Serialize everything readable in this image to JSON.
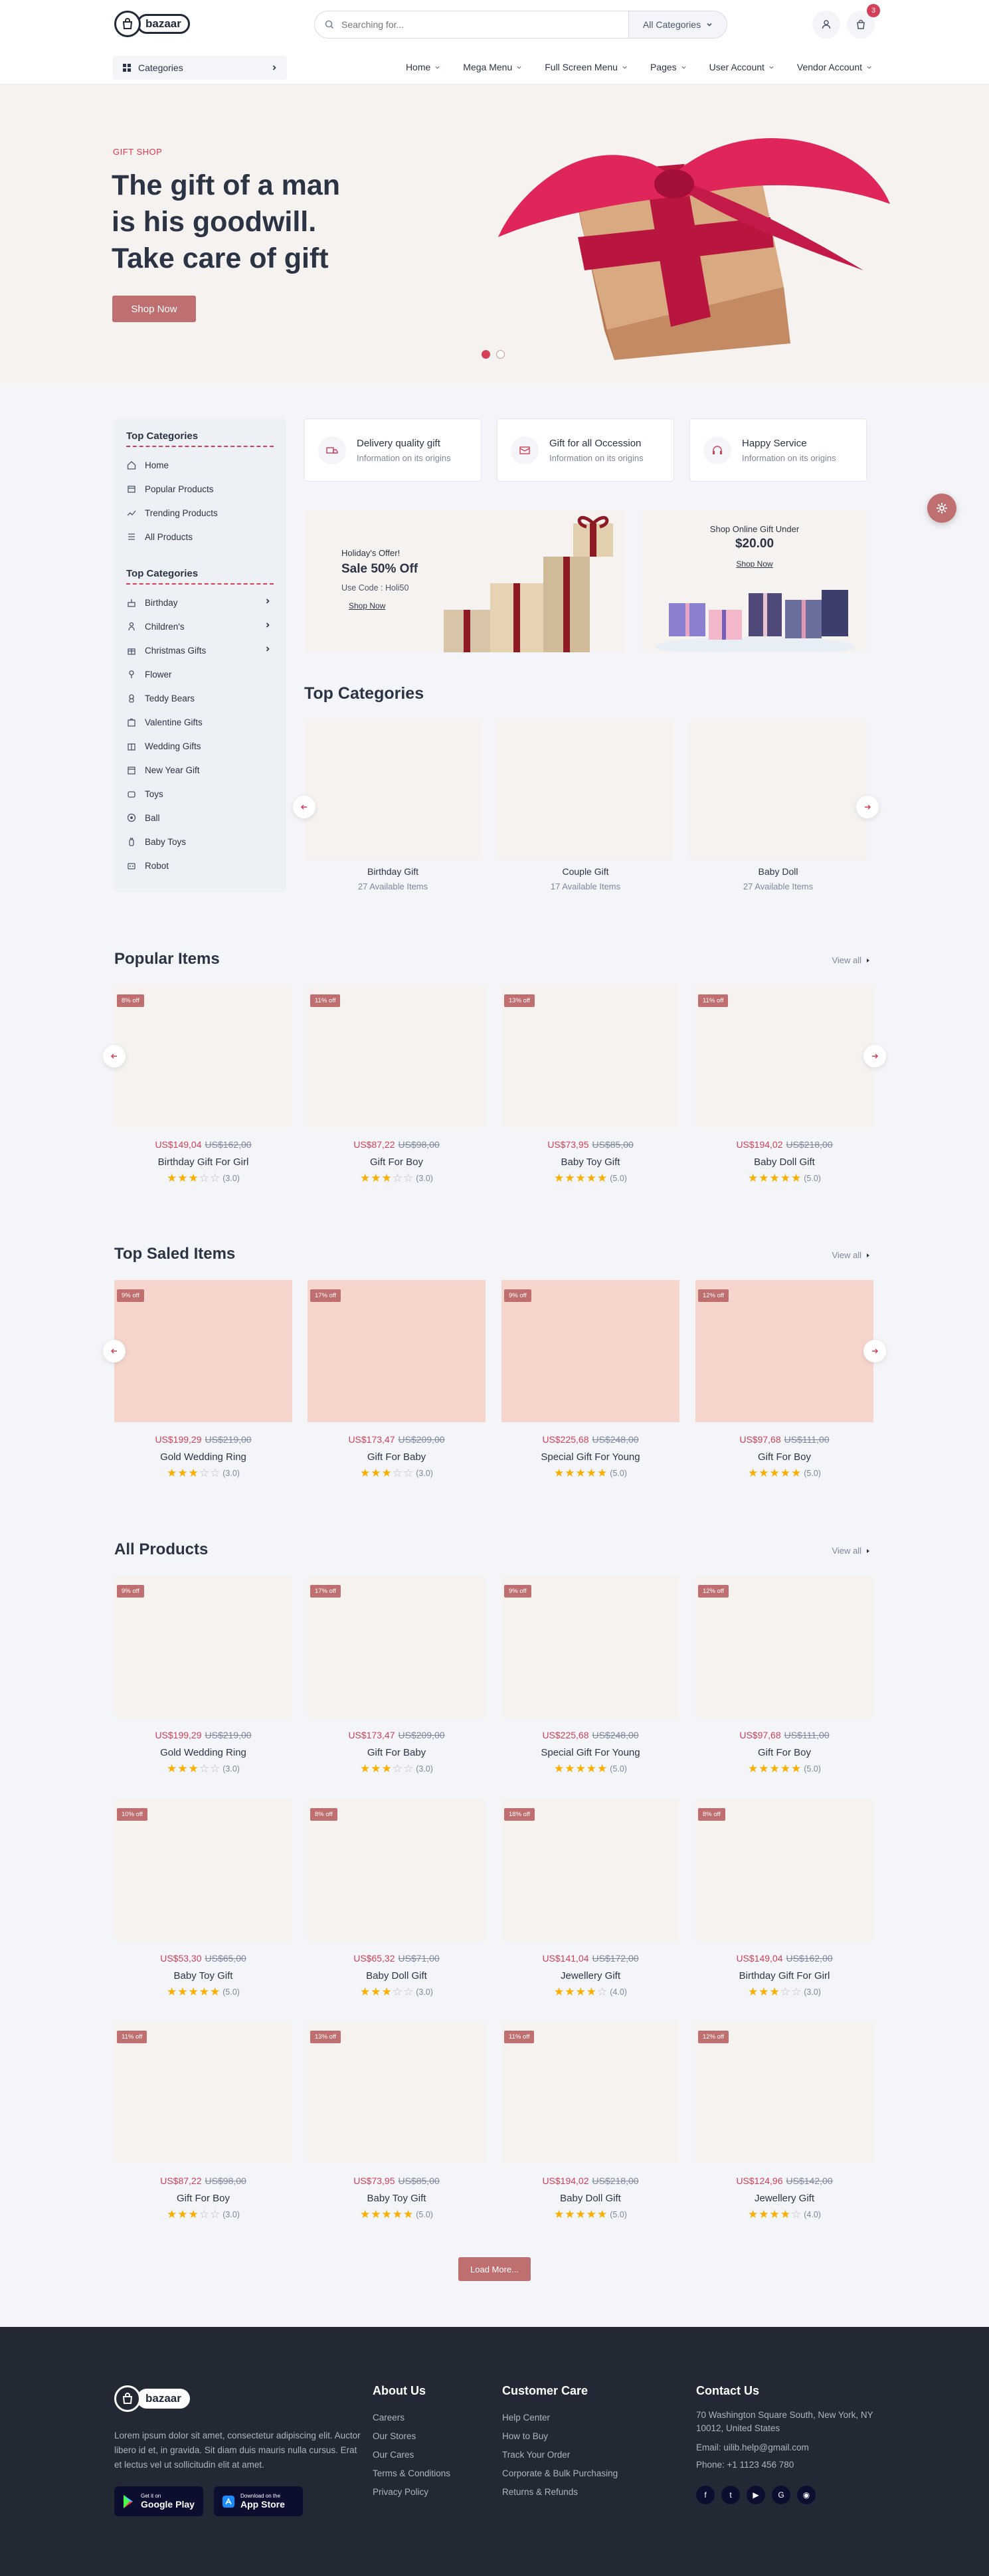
{
  "header": {
    "logo_text": "bazaar",
    "search_placeholder": "Searching for...",
    "search_category": "All Categories",
    "cart_count": "3",
    "categories_button": "Categories",
    "nav": [
      "Home",
      "Mega Menu",
      "Full Screen Menu",
      "Pages",
      "User Account",
      "Vendor Account"
    ]
  },
  "hero": {
    "tag": "GIFT SHOP",
    "title_lines": [
      "The gift of a man",
      "is his goodwill.",
      "Take care of gift"
    ],
    "button": "Shop Now"
  },
  "sidebar": {
    "head1": "Top Categories",
    "items1": [
      "Home",
      "Popular Products",
      "Trending Products",
      "All Products"
    ],
    "head2": "Top Categories",
    "items2": [
      "Birthday",
      "Children's",
      "Christmas Gifts",
      "Flower",
      "Teddy Bears",
      "Valentine Gifts",
      "Wedding Gifts",
      "New Year Gift",
      "Toys",
      "Ball",
      "Baby Toys",
      "Robot"
    ]
  },
  "services": [
    {
      "title": "Delivery quality gift",
      "subtitle": "Information on its origins",
      "icon": "truck-icon"
    },
    {
      "title": "Gift for all Occession",
      "subtitle": "Information on its origins",
      "icon": "card-icon"
    },
    {
      "title": "Happy Service",
      "subtitle": "Information on its origins",
      "icon": "headset-icon"
    }
  ],
  "promo1": {
    "eyebrow": "Holiday's Offer!",
    "title": "Sale 50% Off",
    "code": "Use Code : Holi50",
    "link": "Shop Now"
  },
  "promo2": {
    "eyebrow": "Shop Online Gift Under",
    "price": "$20.00",
    "link": "Shop Now"
  },
  "top_categories": {
    "title": "Top Categories",
    "items": [
      {
        "name": "Birthday Gift",
        "count": "27 Available Items"
      },
      {
        "name": "Couple Gift",
        "count": "17 Available Items"
      },
      {
        "name": "Baby Doll",
        "count": "27 Available Items"
      }
    ]
  },
  "popular": {
    "title": "Popular Items",
    "view_all": "View all",
    "items": [
      {
        "off": "8% off",
        "price": "US$149,04",
        "old": "US$162,00",
        "name": "Birthday Gift For Girl",
        "rating": 3
      },
      {
        "off": "11% off",
        "price": "US$87,22",
        "old": "US$98,00",
        "name": "Gift For Boy",
        "rating": 3
      },
      {
        "off": "13% off",
        "price": "US$73,95",
        "old": "US$85,00",
        "name": "Baby Toy Gift",
        "rating": 5
      },
      {
        "off": "11% off",
        "price": "US$194,02",
        "old": "US$218,00",
        "name": "Baby Doll Gift",
        "rating": 5
      }
    ]
  },
  "top_saled": {
    "title": "Top Saled Items",
    "view_all": "View all",
    "items": [
      {
        "off": "9% off",
        "price": "US$199,29",
        "old": "US$219,00",
        "name": "Gold Wedding Ring",
        "rating": 3
      },
      {
        "off": "17% off",
        "price": "US$173,47",
        "old": "US$209,00",
        "name": "Gift For Baby",
        "rating": 3
      },
      {
        "off": "9% off",
        "price": "US$225,68",
        "old": "US$248,00",
        "name": "Special Gift For Young",
        "rating": 5
      },
      {
        "off": "12% off",
        "price": "US$97,68",
        "old": "US$111,00",
        "name": "Gift For Boy",
        "rating": 5
      }
    ]
  },
  "all_products": {
    "title": "All Products",
    "view_all": "View all",
    "items": [
      {
        "off": "9% off",
        "price": "US$199,29",
        "old": "US$219,00",
        "name": "Gold Wedding Ring",
        "rating": 3
      },
      {
        "off": "17% off",
        "price": "US$173,47",
        "old": "US$209,00",
        "name": "Gift For Baby",
        "rating": 3
      },
      {
        "off": "9% off",
        "price": "US$225,68",
        "old": "US$248,00",
        "name": "Special Gift For Young",
        "rating": 5
      },
      {
        "off": "12% off",
        "price": "US$97,68",
        "old": "US$111,00",
        "name": "Gift For Boy",
        "rating": 5
      },
      {
        "off": "10% off",
        "price": "US$53,30",
        "old": "US$65,00",
        "name": "Baby Toy Gift",
        "rating": 5
      },
      {
        "off": "8% off",
        "price": "US$65,32",
        "old": "US$71,00",
        "name": "Baby Doll Gift",
        "rating": 3
      },
      {
        "off": "18% off",
        "price": "US$141,04",
        "old": "US$172,00",
        "name": "Jewellery Gift",
        "rating": 4
      },
      {
        "off": "8% off",
        "price": "US$149,04",
        "old": "US$162,00",
        "name": "Birthday Gift For Girl",
        "rating": 3
      },
      {
        "off": "11% off",
        "price": "US$87,22",
        "old": "US$98,00",
        "name": "Gift For Boy",
        "rating": 3
      },
      {
        "off": "13% off",
        "price": "US$73,95",
        "old": "US$85,00",
        "name": "Baby Toy Gift",
        "rating": 5
      },
      {
        "off": "11% off",
        "price": "US$194,02",
        "old": "US$218,00",
        "name": "Baby Doll Gift",
        "rating": 5
      },
      {
        "off": "12% off",
        "price": "US$124,96",
        "old": "US$142,00",
        "name": "Jewellery Gift",
        "rating": 4
      }
    ],
    "load_more": "Load More..."
  },
  "footer": {
    "about_text": "Lorem ipsum dolor sit amet, consectetur adipiscing elit. Auctor libero id et, in gravida. Sit diam duis mauris nulla cursus. Erat et lectus vel ut sollicitudin elit at amet.",
    "google_small": "Get it on",
    "google_big": "Google Play",
    "apple_small": "Download on the",
    "apple_big": "App Store",
    "about_head": "About Us",
    "about_links": [
      "Careers",
      "Our Stores",
      "Our Cares",
      "Terms & Conditions",
      "Privacy Policy"
    ],
    "care_head": "Customer Care",
    "care_links": [
      "Help Center",
      "How to Buy",
      "Track Your Order",
      "Corporate & Bulk Purchasing",
      "Returns & Refunds"
    ],
    "contact_head": "Contact Us",
    "address": "70 Washington Square South, New York, NY 10012, United States",
    "email": "Email: uilib.help@gmail.com",
    "phone": "Phone: +1 1123 456 780",
    "social": [
      "f",
      "t",
      "yt",
      "g",
      "ig"
    ]
  },
  "colors": {
    "primary": "#d23f57",
    "button": "#bf6f6f",
    "dark": "#2b3445",
    "footer": "#222935",
    "star": "#faaf00"
  }
}
